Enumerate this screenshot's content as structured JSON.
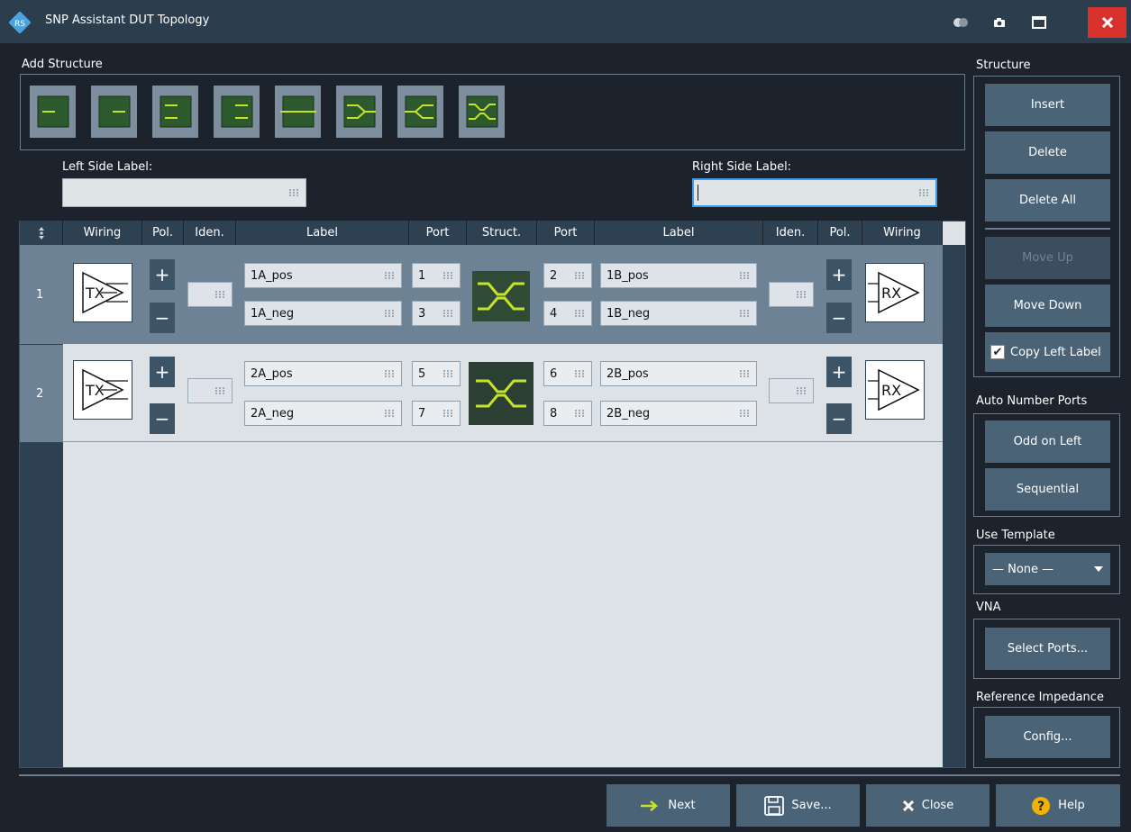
{
  "window": {
    "title": "SNP Assistant DUT Topology"
  },
  "add_structure": {
    "label": "Add Structure"
  },
  "left_side": {
    "label": "Left Side Label:",
    "value": ""
  },
  "right_side": {
    "label": "Right Side Label:",
    "value": ""
  },
  "table": {
    "columns": [
      "Wiring",
      "Pol.",
      "Iden.",
      "Label",
      "Port",
      "Struct.",
      "Port",
      "Label",
      "Iden.",
      "Pol.",
      "Wiring"
    ],
    "rows": [
      {
        "num": "1",
        "left_tx": "TX",
        "left_label_pos": "1A_pos",
        "left_label_neg": "1A_neg",
        "left_port_pos": "1",
        "left_port_neg": "3",
        "right_port_pos": "2",
        "right_port_neg": "4",
        "right_label_pos": "1B_pos",
        "right_label_neg": "1B_neg",
        "right_rx": "RX"
      },
      {
        "num": "2",
        "left_tx": "TX",
        "left_label_pos": "2A_pos",
        "left_label_neg": "2A_neg",
        "left_port_pos": "5",
        "left_port_neg": "7",
        "right_port_pos": "6",
        "right_port_neg": "8",
        "right_label_pos": "2B_pos",
        "right_label_neg": "2B_neg",
        "right_rx": "RX"
      }
    ],
    "plus": "+",
    "minus": "−"
  },
  "structure_panel": {
    "label": "Structure",
    "insert": "Insert",
    "delete": "Delete",
    "delete_all": "Delete All",
    "move_up": "Move Up",
    "move_down": "Move Down",
    "copy_left_label": "Copy Left Label",
    "copy_checked": true
  },
  "auto_number": {
    "label": "Auto Number Ports",
    "odd_on_left": "Odd on Left",
    "sequential": "Sequential"
  },
  "use_template": {
    "label": "Use Template",
    "value": "— None —"
  },
  "vna": {
    "label": "VNA",
    "select_ports": "Select Ports..."
  },
  "ref_impedance": {
    "label": "Reference Impedance",
    "config": "Config..."
  },
  "bottom": {
    "next": "Next",
    "save": "Save...",
    "close": "Close",
    "help": "Help"
  },
  "colors": {
    "accent_green": "#c6e22a",
    "structure_green": "#2f4a35",
    "close_red": "#d9322c",
    "button": "#4b6377"
  }
}
